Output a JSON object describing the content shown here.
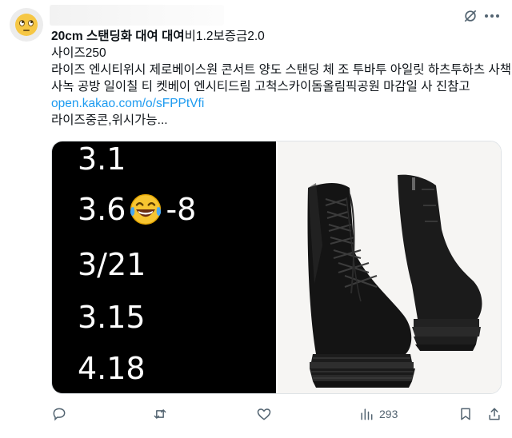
{
  "post": {
    "line1_bold": "20cm 스탠딩화 대여 대여",
    "line1_rest": "비1.2보증금2.0",
    "line2": "사이즈250",
    "line3": "라이즈 엔시티위시 제로베이스원 콘서트 양도 스탠딩 체 조 투바투 아일릿 하츠투하츠 사책",
    "line4": "사녹 공방 일이칠 티 켓베이 엔시티드림 고척스카이돔올림픽공원 마감일 사 진참고",
    "link": "open.kakao.com/o/sFPPtVfi",
    "line6": "라이즈중콘,위시가능..."
  },
  "media": {
    "dates": [
      "3.1",
      "3.6",
      "-8",
      "3/21",
      "3.15",
      "4.18"
    ]
  },
  "actions": {
    "views": "293"
  },
  "colors": {
    "link": "#1d9bf0",
    "icon": "#536471"
  }
}
